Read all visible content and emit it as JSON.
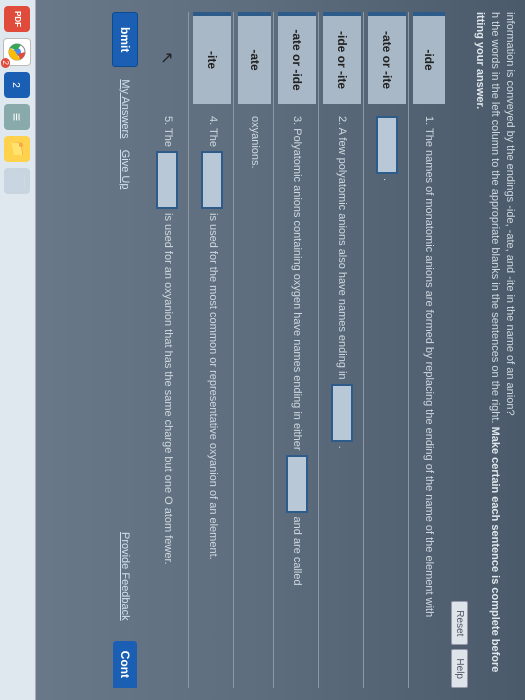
{
  "instructions": {
    "line1": "information is conveyed by the endings -ide, -ate, and -ite in the name of an anion?",
    "line2a": "h the words in the left column to the appropriate blanks in the sentences on the right. ",
    "line2b": "Make certain each sentence is complete before",
    "line3b": "itting your answer."
  },
  "buttons": {
    "reset": "Reset",
    "help": "Help",
    "submit": "bmit",
    "cont": "Cont"
  },
  "drags": [
    "-ide",
    "-ate or -ite",
    "-ide or -ite",
    "-ate or -ide",
    "-ate",
    "-ite"
  ],
  "sentences": {
    "s1a": "1. The names of monatomic anions are formed by replacing the ending of the name of the element with",
    "s1b": ".",
    "s2a": "2. A few polyatomic anions also have names ending in",
    "s2b": ".",
    "s3a": "3. Polyatomic anions containing oxygen have names ending in either",
    "s3b": "and are called",
    "s3c": "oxyanions.",
    "s4a": "4. The",
    "s4b": "is used for the most common or representative oxyanion of an element.",
    "s5a": "5. The",
    "s5b": "is used for an oxyanion that has the same charge but one O atom fewer."
  },
  "links": {
    "my": "My Answers",
    "gu": "Give Up",
    "pf": "Provide Feedback"
  },
  "icons": {
    "cursor": "↖",
    "pdf": "PDF",
    "num": "2"
  }
}
